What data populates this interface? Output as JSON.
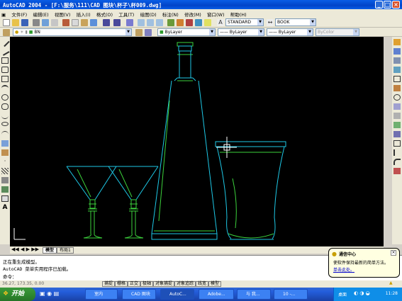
{
  "window": {
    "title": "AutoCAD 2004 - [F:\\服务\\111\\CAD 图块\\杯子\\杯009.dwg]",
    "minimize": "_",
    "maximize": "□",
    "close": "×"
  },
  "menu": [
    "文件(F)",
    "编辑(E)",
    "视图(V)",
    "插入(I)",
    "格式(O)",
    "工具(T)",
    "绘图(D)",
    "标注(N)",
    "修改(M)",
    "窗口(W)",
    "帮助(H)"
  ],
  "styles": {
    "text_style": "STANDARD",
    "dim_style": "BOOK"
  },
  "layers": {
    "current_layer": "BN",
    "color": "ByLayer",
    "linetype": "ByLayer",
    "lineweight": "ByLayer",
    "plot_style": "ByColor"
  },
  "tabs": [
    "模型",
    "布局1"
  ],
  "command_lines": [
    "正在重生成模型。",
    "AutoCAD 菜单实用程序已加载。",
    "命令："
  ],
  "status": {
    "coords": "36.27, 173.35, 0.00",
    "toggles": [
      "捕捉",
      "栅格",
      "正交",
      "极轴",
      "对象捕捉",
      "对象追踪",
      "线宽",
      "模型"
    ]
  },
  "taskbar": {
    "start": "开始",
    "tasks": [
      "室内",
      "CAD 图块",
      "AutoC...",
      "Adobe...",
      "与 我...",
      "10 -..."
    ],
    "tray_desktop": "桌面",
    "clock": "11:28"
  },
  "balloon": {
    "title": "通信中心",
    "body": "使软件保持最新的简单方法。",
    "link": "单击此处。"
  },
  "colors": {
    "canvas": "#000000",
    "drawing_cyan": "#1ec8e6",
    "drawing_green": "#3cd23c",
    "crosshair": "#ffffff"
  }
}
